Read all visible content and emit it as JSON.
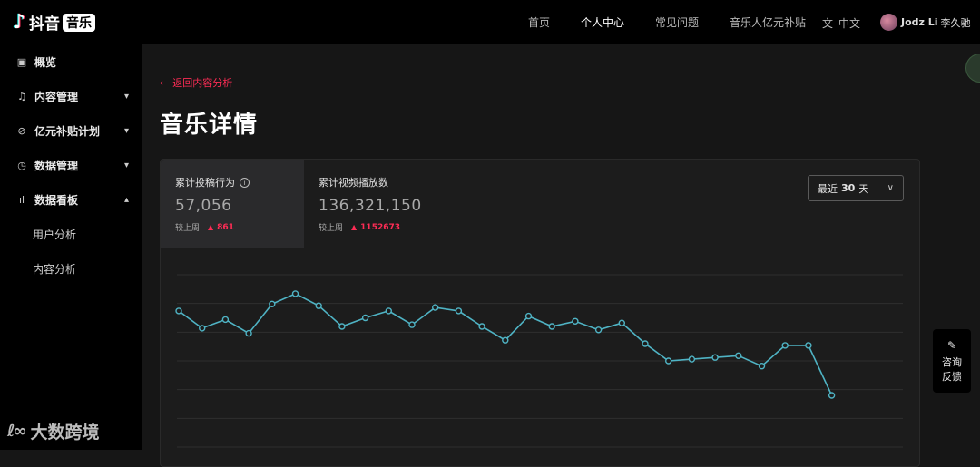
{
  "header": {
    "logo_text": "抖音",
    "logo_badge": "音乐",
    "nav": [
      "首页",
      "个人中心",
      "常见问题",
      "音乐人亿元补贴"
    ],
    "active_nav": "个人中心",
    "lang": "中文",
    "user_name": "Jodz Li",
    "user_cn": "李久驰"
  },
  "sidebar": {
    "items": [
      {
        "label": "概览",
        "icon": "layout-icon"
      },
      {
        "label": "内容管理",
        "icon": "music-note-icon"
      },
      {
        "label": "亿元补贴计划",
        "icon": "paperclip-icon"
      },
      {
        "label": "数据管理",
        "icon": "clock-icon"
      },
      {
        "label": "数据看板",
        "icon": "bar-chart-icon"
      }
    ],
    "sub_items": [
      "用户分析",
      "内容分析"
    ]
  },
  "watermark": "大数跨境",
  "page": {
    "back_link": "返回内容分析",
    "title": "音乐详情"
  },
  "metrics": [
    {
      "label": "累计投稿行为",
      "value": "57,056",
      "compare_label": "较上周",
      "delta": "861"
    },
    {
      "label": "累计视频播放数",
      "value": "136,321,150",
      "compare_label": "较上周",
      "delta": "1152673"
    }
  ],
  "range_select": {
    "prefix": "最近",
    "value": "30",
    "suffix": "天"
  },
  "floating": {
    "line1": "咨询",
    "line2": "反馈"
  },
  "colors": {
    "accent": "#fe2c55",
    "line": "#4fb3c4"
  },
  "chart_data": {
    "type": "line",
    "ylim": [
      0,
      100
    ],
    "grid": true,
    "series": [
      {
        "values": [
          79,
          69,
          74,
          66,
          83,
          89,
          82,
          70,
          75,
          79,
          71,
          81,
          79,
          70,
          62,
          76,
          70,
          73,
          68,
          72,
          60,
          50,
          51,
          52,
          53,
          47,
          59,
          59,
          30
        ]
      }
    ]
  }
}
